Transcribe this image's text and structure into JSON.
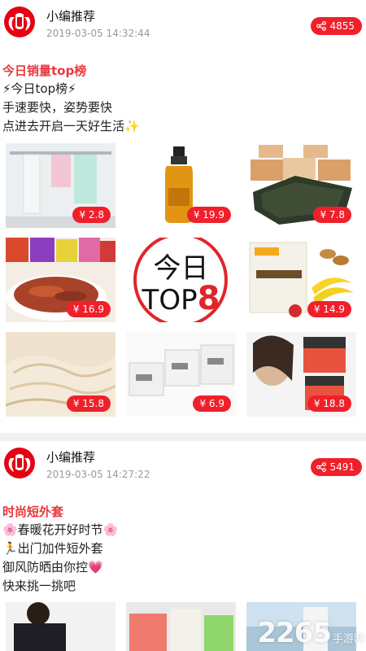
{
  "colors": {
    "accent": "#f0202a",
    "title_red": "#e8383d",
    "meta_gray": "#999999"
  },
  "posts": [
    {
      "author": "小编推荐",
      "time": "2019-03-05 14:32:44",
      "share_count": "4855",
      "title": "今日销量top榜",
      "lines": [
        "⚡今日top榜⚡",
        "手速要快，姿势要快",
        "点进去开启一天好生活✨"
      ],
      "products": [
        {
          "name": "towel-rack",
          "price": "¥ 2.8"
        },
        {
          "name": "hair-oil",
          "price": "¥ 19.9"
        },
        {
          "name": "seaweed-snack",
          "price": "¥ 7.8"
        },
        {
          "name": "jerky-snack",
          "price": "¥ 16.9"
        },
        {
          "name": "top8-badge",
          "price": ""
        },
        {
          "name": "nuts-fruit",
          "price": "¥ 14.9"
        },
        {
          "name": "shredded-squid",
          "price": "¥ 15.8"
        },
        {
          "name": "tissue-boxes",
          "price": "¥ 6.9"
        },
        {
          "name": "face-cream",
          "price": "¥ 18.8"
        }
      ],
      "badge_line1": "今日",
      "badge_line2": "TOP",
      "badge_num": "8"
    },
    {
      "author": "小编推荐",
      "time": "2019-03-05 14:27:22",
      "share_count": "5491",
      "title": "时尚短外套",
      "lines": [
        "🌸春暖花开好时节🌸",
        "🏃出门加件短外套",
        "御风防晒由你控💗",
        "快来挑一挑吧"
      ]
    }
  ],
  "watermark": {
    "main": "2265",
    "sub": "手游网"
  }
}
